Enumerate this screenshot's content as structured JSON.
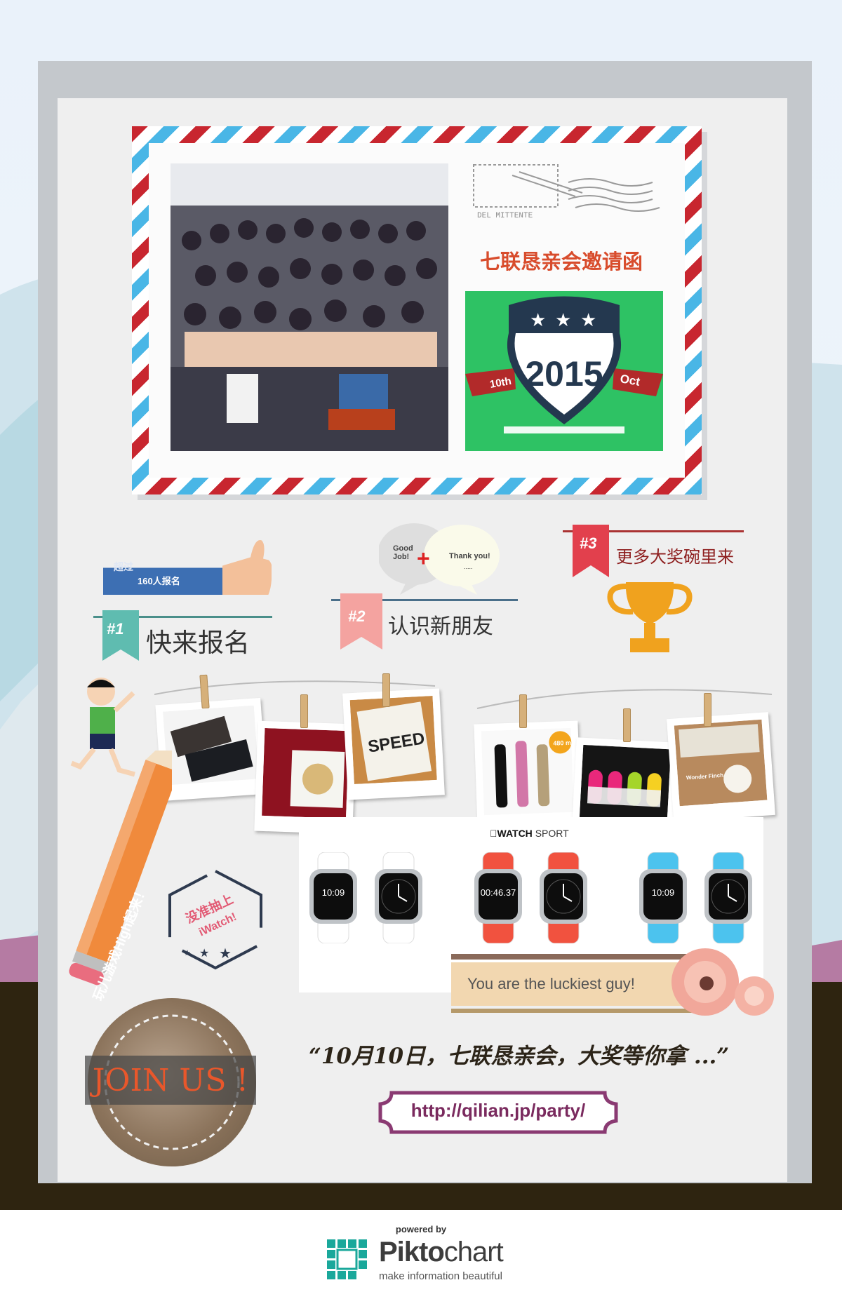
{
  "invite": {
    "title": "七联恳亲会邀请函",
    "badge_year": "2015",
    "badge_day": "10th",
    "badge_month": "Oct"
  },
  "section1": {
    "number": "#1",
    "title": "快来报名",
    "signup_top": "超过",
    "signup_count": "160人报名"
  },
  "section2": {
    "number": "#2",
    "title": "认识新朋友",
    "bubble_left": "Good Job!",
    "bubble_plus": "+",
    "bubble_right": "Thank you!",
    "bubble_dots": "....."
  },
  "section3": {
    "number": "#3",
    "title": "更多大奖碗里来"
  },
  "prizes": {
    "book_word": "SPEED",
    "bottle_badge": "480 ml",
    "watch_brand": "WATCH",
    "watch_brand_suffix": "SPORT",
    "cafe_sign": "Wonder Finch",
    "watch_times": [
      "10:09",
      "10:09",
      "00:46.37",
      "10:09",
      "10:09",
      "7:30"
    ]
  },
  "pencil_text": "玩儿游戏High起来！",
  "hexagon": {
    "line1": "没准抽上",
    "line2": "iWatch!"
  },
  "lucky_text": "You are the luckiest guy!",
  "join_text": "JOIN US !",
  "quote_text": "“10月10日，七联恳亲会，大奖等你拿 ...”",
  "url_text": "http://qilian.jp/party/",
  "footer": {
    "powered": "powered by",
    "brand_bold": "Pikto",
    "brand_light": "chart",
    "tagline": "make information beautiful"
  },
  "colors": {
    "airmail_red": "#c8262f",
    "airmail_blue": "#49b6e6",
    "badge_green": "#2ec264",
    "ribbon1": "#5fbcb0",
    "ribbon2": "#f4a3a0",
    "ribbon3": "#e2404d",
    "trophy": "#f0a21e",
    "title_orange": "#d84c2c",
    "join_orange": "#e9572b",
    "url_purple": "#7a2a5e"
  }
}
